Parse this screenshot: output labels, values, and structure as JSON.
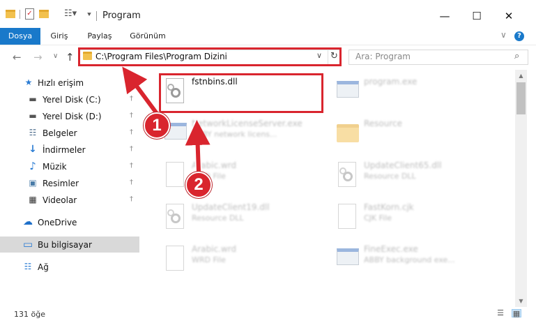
{
  "window": {
    "title": "Program",
    "minimize_glyph": "—",
    "maximize_glyph": "☐",
    "close_glyph": "✕"
  },
  "ribbon": {
    "tabs": [
      {
        "label": "Dosya",
        "active": true
      },
      {
        "label": "Giriş",
        "active": false
      },
      {
        "label": "Paylaş",
        "active": false
      },
      {
        "label": "Görünüm",
        "active": false
      }
    ],
    "expand_glyph": "∨",
    "help_glyph": "?"
  },
  "navigation": {
    "back_glyph": "←",
    "forward_glyph": "→",
    "recent_glyph": "∨",
    "up_glyph": "↑"
  },
  "address": {
    "path": "C:\\Program Files\\Program Dizini",
    "dropdown_glyph": "∨",
    "refresh_glyph": "↻"
  },
  "search": {
    "placeholder": "Ara: Program",
    "icon_glyph": "⌕"
  },
  "sidebar": {
    "items": [
      {
        "label": "Hızlı erişim",
        "icon": "star-icon",
        "glyph": "★",
        "color": "#2b7cd3",
        "pinned": false
      },
      {
        "label": "Yerel Disk (C:)",
        "icon": "drive-icon",
        "glyph": "▬",
        "color": "#555555",
        "pinned": true
      },
      {
        "label": "Yerel Disk (D:)",
        "icon": "drive-icon",
        "glyph": "▬",
        "color": "#555555",
        "pinned": true
      },
      {
        "label": "Belgeler",
        "icon": "documents-icon",
        "glyph": "☷",
        "color": "#4a6a8a",
        "pinned": true
      },
      {
        "label": "İndirmeler",
        "icon": "downloads-icon",
        "glyph": "↓",
        "color": "#2b7cd3",
        "pinned": true
      },
      {
        "label": "Müzik",
        "icon": "music-icon",
        "glyph": "♪",
        "color": "#2b7cd3",
        "pinned": true
      },
      {
        "label": "Resimler",
        "icon": "pictures-icon",
        "glyph": "▣",
        "color": "#4a7ca8",
        "pinned": true
      },
      {
        "label": "Videolar",
        "icon": "videos-icon",
        "glyph": "▦",
        "color": "#333333",
        "pinned": true
      },
      {
        "label": "OneDrive",
        "icon": "cloud-icon",
        "glyph": "☁",
        "color": "#1e6fc9",
        "pinned": false
      },
      {
        "label": "Bu bilgisayar",
        "icon": "computer-icon",
        "glyph": "▭",
        "color": "#2b7cd3",
        "pinned": false
      },
      {
        "label": "Ağ",
        "icon": "network-icon",
        "glyph": "☷",
        "color": "#2b7cd3",
        "pinned": false
      }
    ],
    "pin_glyph": "†"
  },
  "files": [
    {
      "name": "fstnbins.dll",
      "desc": "",
      "icon": "dll-file-icon",
      "blurred": false
    },
    {
      "name": "program.exe",
      "desc": "",
      "icon": "exe-file-icon",
      "blurred": true
    },
    {
      "name": "NetworkLicenseServer.exe",
      "desc": "ABBY network licens...",
      "icon": "exe-file-icon",
      "blurred": true
    },
    {
      "name": "Resource",
      "desc": "",
      "icon": "folder-icon",
      "blurred": true
    },
    {
      "name": "Arabic.wrd",
      "desc": "WRD File",
      "icon": "document-file-icon",
      "blurred": true
    },
    {
      "name": "UpdateClient65.dll",
      "desc": "Resource DLL",
      "icon": "dll-file-icon",
      "blurred": true
    },
    {
      "name": "UpdateClient19.dll",
      "desc": "Resource DLL",
      "icon": "dll-file-icon",
      "blurred": true
    },
    {
      "name": "FastKorn.cjk",
      "desc": "CJK File",
      "icon": "document-file-icon",
      "blurred": true
    },
    {
      "name": "Arabic.wrd",
      "desc": "WRD File",
      "icon": "document-file-icon",
      "blurred": true
    },
    {
      "name": "FineExec.exe",
      "desc": "ABBY background exe...",
      "icon": "exe-file-icon",
      "blurred": true
    }
  ],
  "status": {
    "count": "131 öğe"
  },
  "scrollbar": {
    "up_glyph": "▲",
    "down_glyph": "▼"
  },
  "annotations": {
    "step1": "1",
    "step2": "2",
    "color": "#d9252e"
  }
}
